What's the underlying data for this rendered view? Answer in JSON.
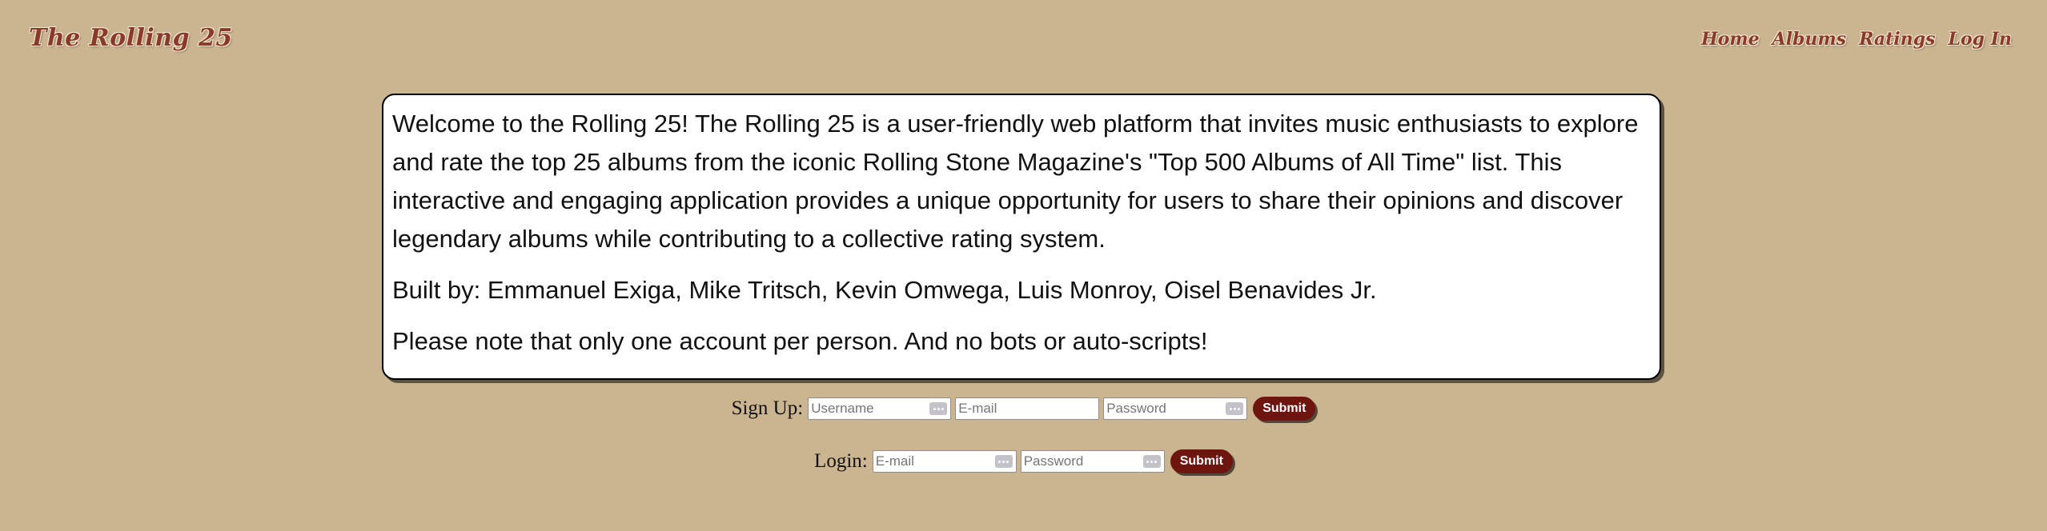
{
  "header": {
    "brand": "The Rolling 25",
    "nav": {
      "home": "Home",
      "albums": "Albums",
      "ratings": "Ratings",
      "login": "Log In"
    }
  },
  "intro": {
    "welcome": "Welcome to the Rolling 25! The Rolling 25 is a user-friendly web platform that invites music enthusiasts to explore and rate the top 25 albums from the iconic Rolling Stone Magazine's \"Top 500 Albums of All Time\" list. This interactive and engaging application provides a unique opportunity for users to share their opinions and discover legendary albums while contributing to a collective rating system.",
    "built_by": "Built by: Emmanuel Exiga, Mike Tritsch, Kevin Omwega, Luis Monroy, Oisel Benavides Jr.",
    "note": "Please note that only one account per person. And no bots or auto-scripts!"
  },
  "signup": {
    "label": "Sign Up:",
    "username_placeholder": "Username",
    "email_placeholder": "E-mail",
    "password_placeholder": "Password",
    "submit_label": "Submit"
  },
  "login": {
    "label": "Login:",
    "email_placeholder": "E-mail",
    "password_placeholder": "Password",
    "submit_label": "Submit"
  },
  "icons": {
    "autofill": "key-autofill-icon"
  },
  "colors": {
    "background": "#cbb591",
    "brand": "#8b3a2a",
    "button": "#6e1510"
  }
}
